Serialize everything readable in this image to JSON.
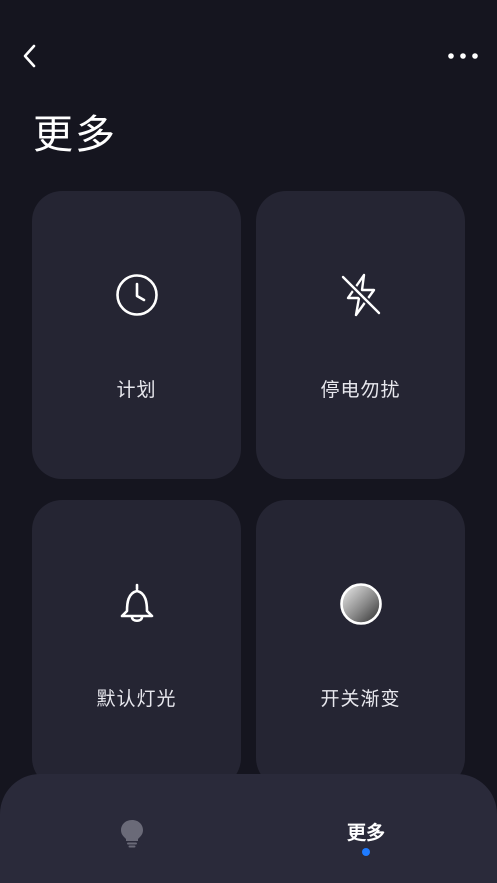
{
  "header": {
    "title": "更多",
    "back_icon": "chevron-left-icon",
    "menu_icon": "more-dots-icon"
  },
  "cards": [
    {
      "label": "计划",
      "icon": "clock-icon"
    },
    {
      "label": "停电勿扰",
      "icon": "no-lightning-icon"
    },
    {
      "label": "默认灯光",
      "icon": "bell-icon"
    },
    {
      "label": "开关渐变",
      "icon": "gradient-circle-icon"
    }
  ],
  "bottom_nav": {
    "items": [
      {
        "label": "",
        "icon": "bulb-icon",
        "active": false
      },
      {
        "label": "更多",
        "icon": "",
        "active": true
      }
    ],
    "active_color": "#1e7bff"
  },
  "colors": {
    "background": "#15151f",
    "card": "#252533",
    "nav": "#2a2a3a"
  }
}
